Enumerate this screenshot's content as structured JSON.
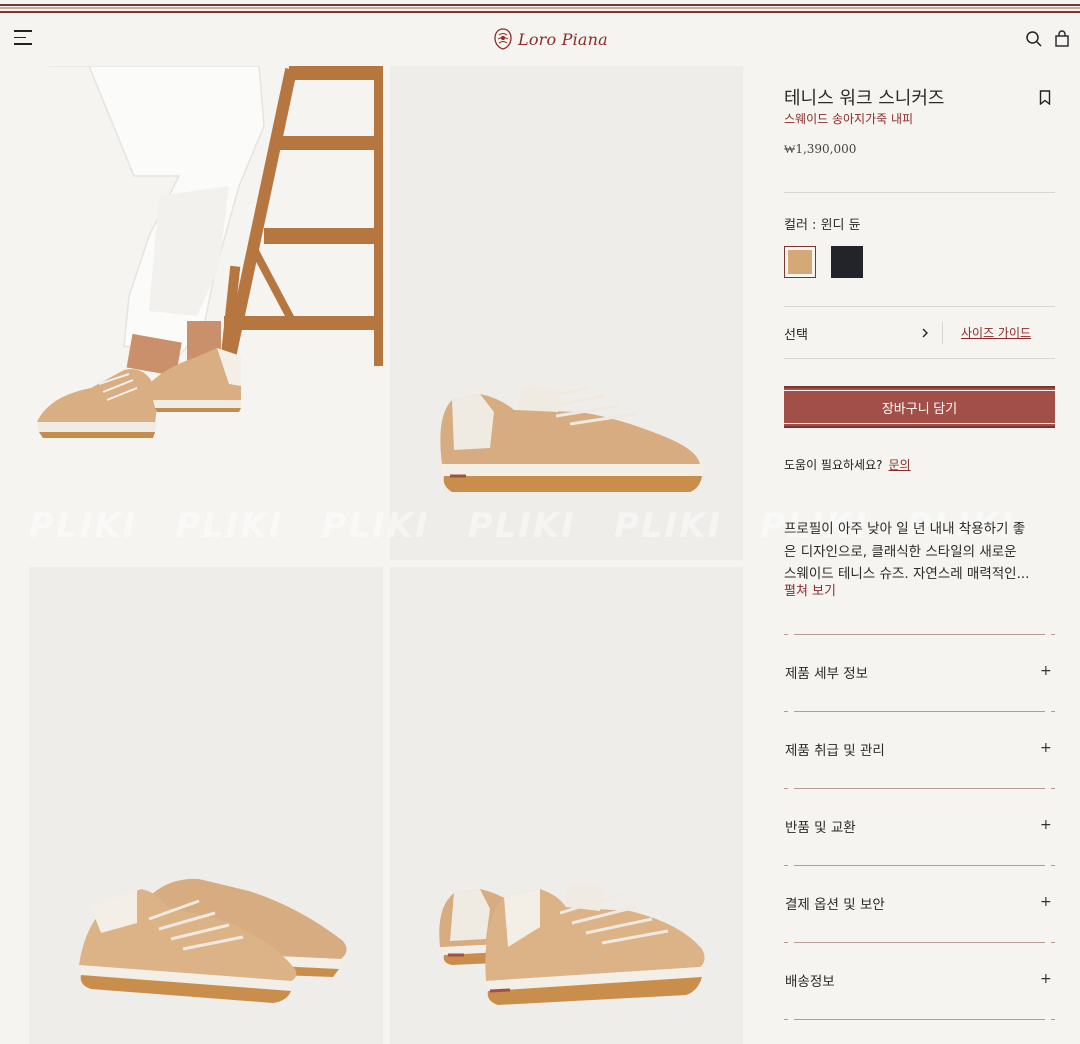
{
  "header": {
    "brand": "Loro Piana",
    "icons": [
      "menu-icon",
      "search-icon",
      "shopping-bag-icon"
    ]
  },
  "gallery": {
    "watermark": [
      "PLIKI",
      "PLIKI",
      "PLIKI",
      "PLIKI",
      "PLIKI",
      "PLIKI",
      "PLIKI"
    ]
  },
  "product": {
    "title": "테니스 워크 스니커즈",
    "subtitle": "스웨이드 송아지가죽 내피",
    "price": "₩1,390,000",
    "color_label": "컬러 : 윈디 듄",
    "swatches": [
      {
        "name": "윈디 듄",
        "hex": "#d5a878",
        "selected": true
      },
      {
        "name": "dark",
        "hex": "#22242a",
        "selected": false
      }
    ],
    "select_label": "선택",
    "size_guide": "사이즈 가이드",
    "cart_button": "장바구니 담기",
    "help_text": "도움이 필요하세요?",
    "help_link": "문의",
    "description_lines": [
      "프로필이 아주 낮아 일 년 내내 착용하기 좋",
      "은 디자인으로, 클래식한 스타일의 새로운",
      "스웨이드 테니스 슈즈. 자연스레 매력적인..."
    ],
    "read_more": "펼쳐 보기",
    "accordion": [
      {
        "title": "제품 세부 정보",
        "icon": "+"
      },
      {
        "title": "제품 취급 및 관리",
        "icon": "+"
      },
      {
        "title": "반품 및 교환",
        "icon": "+"
      },
      {
        "title": "결제 옵션 및 보안",
        "icon": "+"
      },
      {
        "title": "배송정보",
        "icon": "+"
      }
    ]
  },
  "colors": {
    "brand": "#8a2d2b",
    "button": "#a34f49",
    "background": "#f5f4f0"
  }
}
